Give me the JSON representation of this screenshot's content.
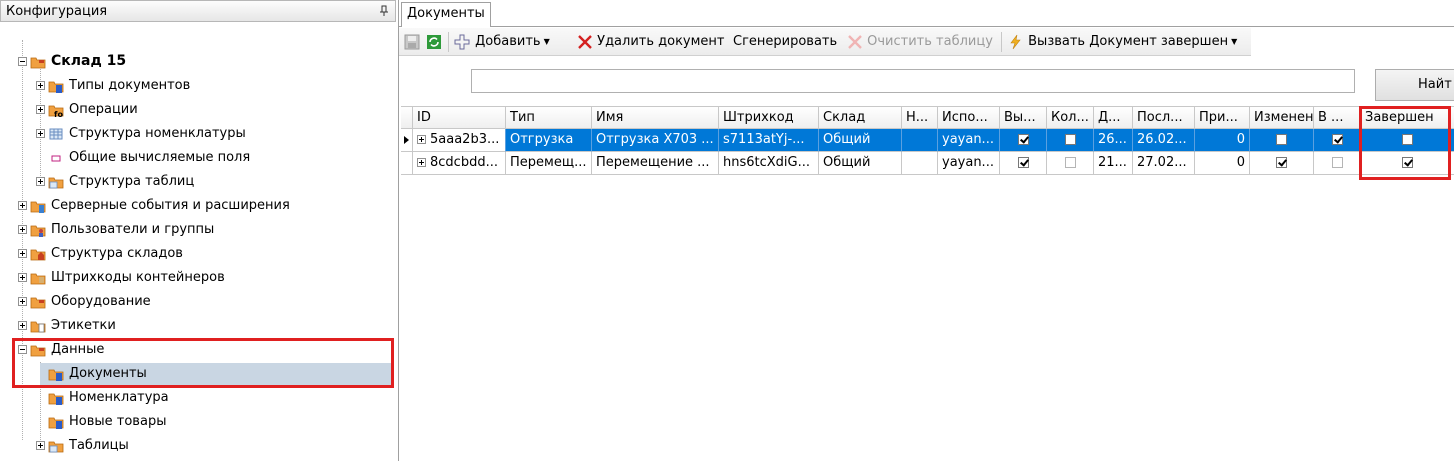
{
  "left_panel": {
    "title": "Конфигурация",
    "tree": [
      {
        "label": "Склад 15",
        "bold": true
      },
      {
        "label": "Типы документов"
      },
      {
        "label": "Операции"
      },
      {
        "label": "Структура номенклатуры"
      },
      {
        "label": "Общие вычисляемые поля"
      },
      {
        "label": "Структура таблиц"
      },
      {
        "label": "Серверные события и расширения"
      },
      {
        "label": "Пользователи и группы"
      },
      {
        "label": "Структура складов"
      },
      {
        "label": "Штрихкоды контейнеров"
      },
      {
        "label": "Оборудование"
      },
      {
        "label": "Этикетки"
      },
      {
        "label": "Данные"
      },
      {
        "label": "Документы",
        "selected": true
      },
      {
        "label": "Номенклатура"
      },
      {
        "label": "Новые товары"
      },
      {
        "label": "Таблицы"
      }
    ]
  },
  "tab": {
    "label": "Документы"
  },
  "toolbar": {
    "add_label": "Добавить",
    "delete_label": "Удалить документ",
    "generate_label": "Сгенерировать",
    "clear_label": "Очистить таблицу",
    "invoke_label": "Вызвать Документ завершен"
  },
  "search": {
    "value": "",
    "find_label": "Найт"
  },
  "grid": {
    "headers": [
      "ID",
      "Тип",
      "Имя",
      "Штрихкод",
      "Склад",
      "Н...",
      "Испо...",
      "Вы...",
      "Кол...",
      "Д...",
      "Посл...",
      "При...",
      "Изменен",
      "В ...",
      "Завершен"
    ],
    "rows": [
      {
        "id": "5aaa2b3...",
        "type": "Отгрузка",
        "name": "Отгрузка X703 ...",
        "barcode": "s7113atYj-...",
        "warehouse": "Общий",
        "n": "",
        "user": "yayan...",
        "date": "26...",
        "last": "26.02...",
        "num": "0"
      },
      {
        "id": "8cdcbdd...",
        "type": "Перемещ...",
        "name": "Перемещение ...",
        "barcode": "hns6tcXdiG...",
        "warehouse": "Общий",
        "n": "",
        "user": "yayan...",
        "date": "21...",
        "last": "27.02...",
        "num": "0"
      }
    ]
  },
  "colors": {
    "selection": "#0078d7",
    "highlight": "#e02020",
    "tree_selected": "#c9d6e3"
  }
}
